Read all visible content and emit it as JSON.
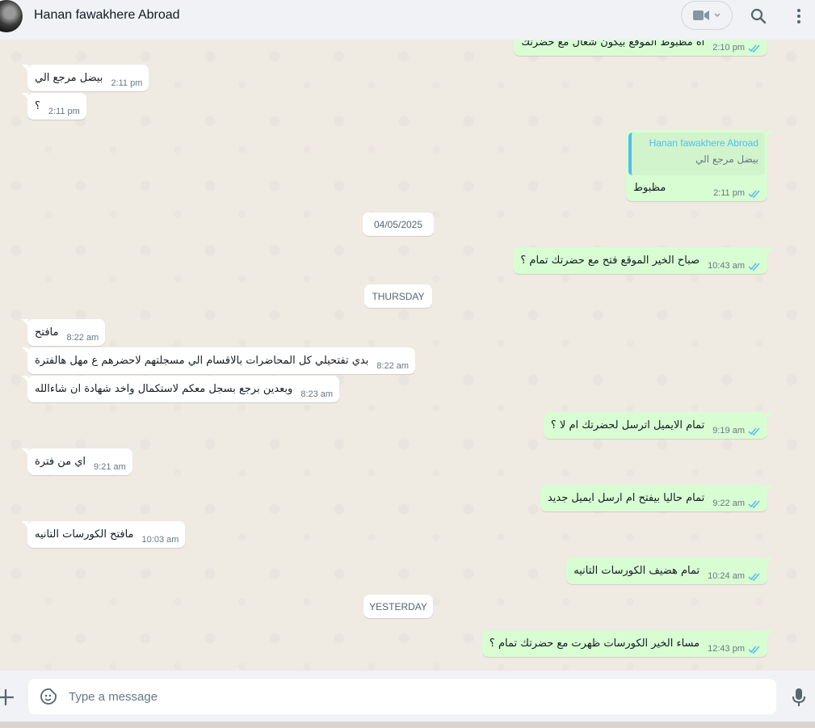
{
  "header": {
    "contact_name": "Hanan fawakhere Abroad",
    "icons": [
      "avatar",
      "video-call-icon",
      "chevron-down-icon",
      "search-icon",
      "menu-icon"
    ]
  },
  "messages": [
    {
      "dir": "out",
      "text": "اه مظبوط الموقع بيكون شغال مع حضرتك",
      "time": "2:10 pm",
      "status": "read"
    },
    {
      "dir": "in",
      "text": "بيضل مرجع الي",
      "time": "2:11 pm"
    },
    {
      "dir": "in",
      "text": "؟",
      "time": "2:11 pm"
    },
    {
      "dir": "out",
      "quoted_author": "Hanan fawakhere Abroad",
      "quoted_text": "بيضل مرجع الي",
      "text": "مظبوط",
      "time": "2:11 pm",
      "status": "read"
    },
    {
      "type": "day",
      "text": "04/05/2025"
    },
    {
      "dir": "out",
      "text": "صباح الخير الموقع فتح مع حضرتك تمام ؟",
      "time": "10:43 am",
      "status": "read"
    },
    {
      "type": "day",
      "text": "THURSDAY"
    },
    {
      "dir": "in",
      "text": "مافتح",
      "time": "8:22 am"
    },
    {
      "dir": "in",
      "text": "بدي تفتحيلي كل المحاضرات بالاقسام الي مسجلتهم لاحضرهم ع مهل هالفترة",
      "time": "8:22 am"
    },
    {
      "dir": "in",
      "text": "وبعدين برجع بسجل معكم لاستكمال واخد شهادة ان شاءالله",
      "time": "8:23 am"
    },
    {
      "dir": "out",
      "text": "تمام الايميل اترسل لحضرتك ام لا ؟",
      "time": "9:19 am",
      "status": "read"
    },
    {
      "dir": "in",
      "text": "اي من فترة",
      "time": "9:21 am"
    },
    {
      "dir": "out",
      "text": "تمام حاليا بيفتح ام ارسل ايميل جديد",
      "time": "9:22 am",
      "status": "read"
    },
    {
      "dir": "in",
      "text": "مافتح الكورسات التانيه",
      "time": "10:03 am"
    },
    {
      "dir": "out",
      "text": "تمام هضيف الكورسات التانيه",
      "time": "10:24 am",
      "status": "read"
    },
    {
      "type": "day",
      "text": "YESTERDAY"
    },
    {
      "dir": "out",
      "text": "مساء الخير الكورسات ظهرت مع حضرتك تمام ؟",
      "time": "12:43 pm",
      "status": "read"
    }
  ],
  "composer": {
    "placeholder": "Type a message",
    "icons": [
      "plus-icon",
      "sticker-icon",
      "microphone-icon"
    ]
  },
  "colors": {
    "chat_bg": "#efeae2",
    "incoming_bubble": "#ffffff",
    "outgoing_bubble": "#d9fdd3",
    "read_tick": "#53bdeb",
    "header_bg": "#f0f2f5"
  }
}
